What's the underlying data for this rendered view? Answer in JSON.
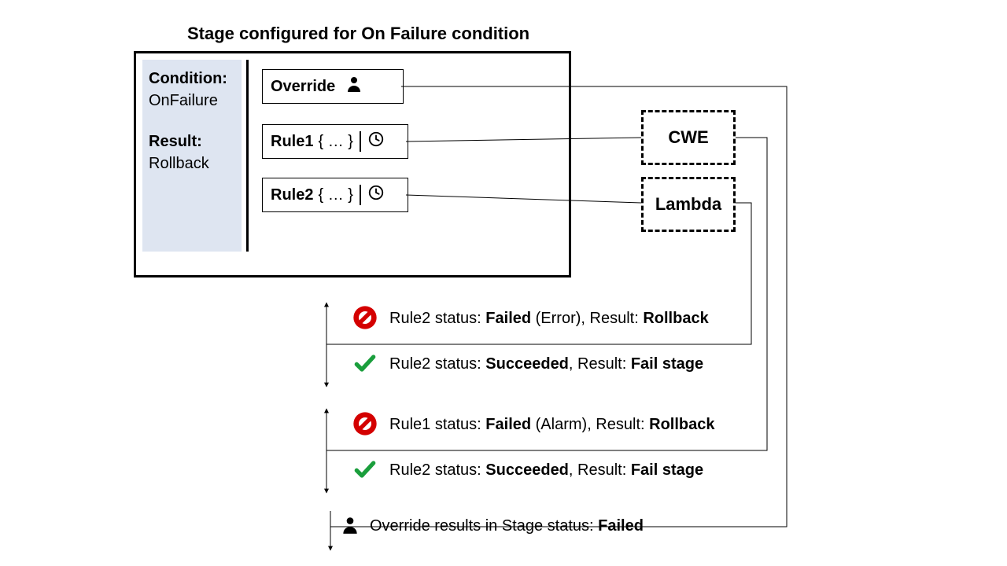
{
  "title": "Stage configured for On Failure condition",
  "panel": {
    "cond_label": "Condition:",
    "cond_value": "OnFailure",
    "result_label": "Result:",
    "result_value": "Rollback"
  },
  "override_label": "Override",
  "rule1_label": "Rule1",
  "rule2_label": "Rule2",
  "rule_body": "{ … }",
  "box_cwe": "CWE",
  "box_lambda": "Lambda",
  "status": {
    "r2_fail_pre": "Rule2 status: ",
    "r2_fail_bold1": "Failed",
    "r2_fail_mid": " (Error), Result: ",
    "r2_fail_bold2": "Rollback",
    "r2_succ_pre": "Rule2 status: ",
    "r2_succ_bold1": "Succeeded",
    "r2_succ_mid": ", Result: ",
    "r2_succ_bold2": "Fail stage",
    "r1_fail_pre": "Rule1 status: ",
    "r1_fail_bold1": "Failed",
    "r1_fail_mid": " (Alarm), Result: ",
    "r1_fail_bold2": "Rollback",
    "r1_succ_pre": "Rule2 status: ",
    "r1_succ_bold1": "Succeeded",
    "r1_succ_mid": ", Result: ",
    "r1_succ_bold2": "Fail stage",
    "override_pre": "Override results in Stage status: ",
    "override_bold": "Failed"
  }
}
